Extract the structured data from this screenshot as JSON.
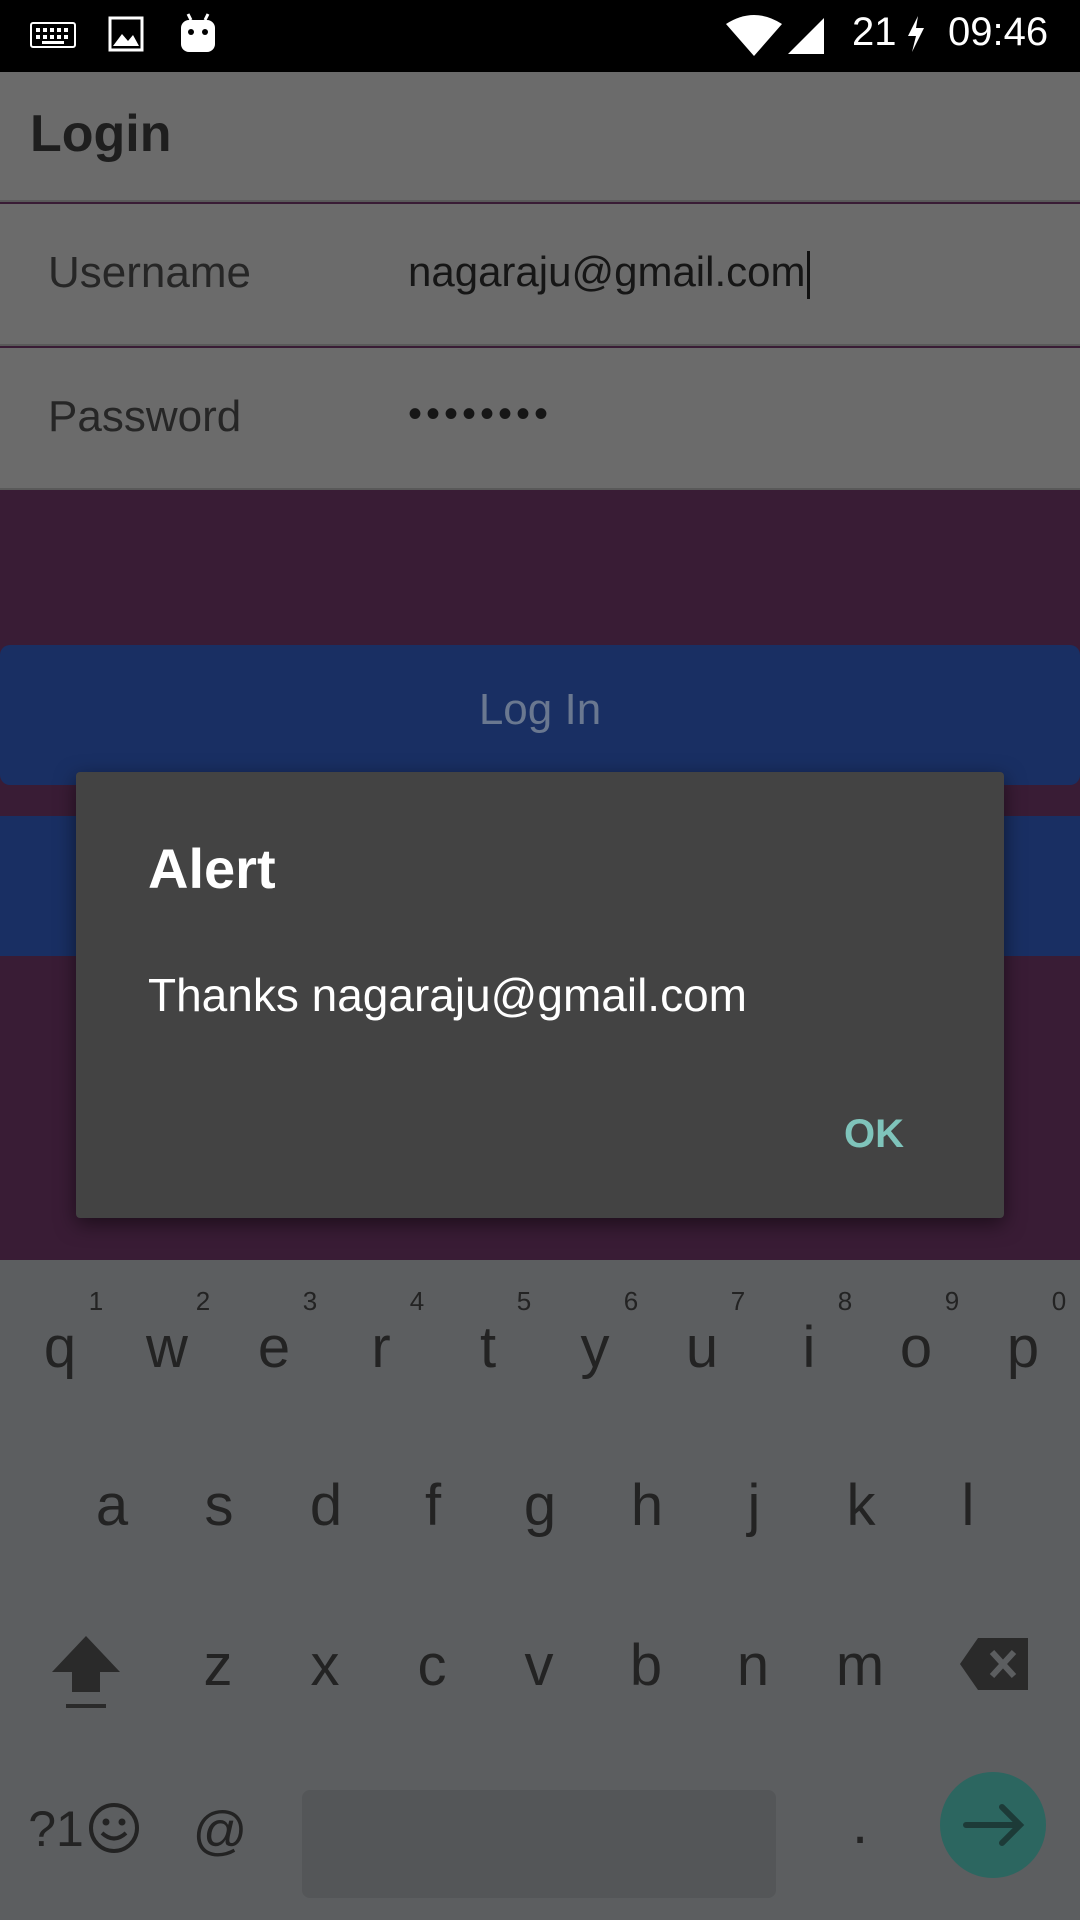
{
  "status_bar": {
    "battery_level": "21",
    "time": "09:46",
    "icons": [
      "keyboard-icon",
      "image-icon",
      "android-icon",
      "wifi-icon",
      "cell-signal-icon",
      "charging-icon"
    ]
  },
  "toolbar": {
    "title": "Login"
  },
  "form": {
    "username_label": "Username",
    "username_value": "nagaraju@gmail.com",
    "password_label": "Password",
    "password_value": "••••••••"
  },
  "login_button": {
    "label": "Log In"
  },
  "dialog": {
    "title": "Alert",
    "message": "Thanks nagaraju@gmail.com",
    "ok_label": "OK"
  },
  "keyboard": {
    "row1": [
      "q",
      "w",
      "e",
      "r",
      "t",
      "y",
      "u",
      "i",
      "o",
      "p"
    ],
    "row1_hints": [
      "1",
      "2",
      "3",
      "4",
      "5",
      "6",
      "7",
      "8",
      "9",
      "0"
    ],
    "row2": [
      "a",
      "s",
      "d",
      "f",
      "g",
      "h",
      "j",
      "k",
      "l"
    ],
    "row3": [
      "z",
      "x",
      "c",
      "v",
      "b",
      "n",
      "m"
    ],
    "symbols_label": "?1",
    "at_label": "@",
    "period_label": "."
  },
  "colors": {
    "accent_teal": "#7fc4bb",
    "button_blue": "#192f63",
    "background_purple": "#391c35"
  }
}
